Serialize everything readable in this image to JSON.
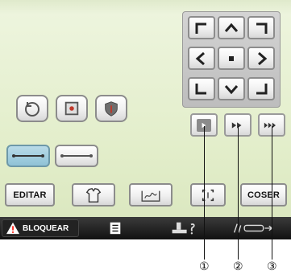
{
  "screen": {
    "buttons": {
      "edit_label": "EDITAR",
      "sew_label": "COSER"
    },
    "statusbar": {
      "lock_label": "BLOQUEAR"
    }
  },
  "callouts": [
    "①",
    "②",
    "③"
  ],
  "colors": {
    "screen_bg": "#e3eecb",
    "arrow": "#222222",
    "button_border": "#8c8c8c",
    "active_stitch": "#8fc2d6",
    "statusbar": "#111111",
    "warning": "#ff3b30"
  },
  "icons": {
    "nav": [
      "corner-up-left-icon",
      "arrow-up-icon",
      "corner-up-right-icon",
      "arrow-left-icon",
      "center-dot-icon",
      "arrow-right-icon",
      "corner-down-left-icon",
      "arrow-down-icon",
      "corner-down-right-icon"
    ],
    "speed": [
      "play-slow-icon",
      "play-medium-icon",
      "play-fast-icon"
    ],
    "left": [
      "rotate-icon",
      "frame-icon",
      "shield-icon"
    ],
    "bottom": [
      "shirt-icon",
      "hoop-icon",
      "trace-frame-icon"
    ]
  }
}
